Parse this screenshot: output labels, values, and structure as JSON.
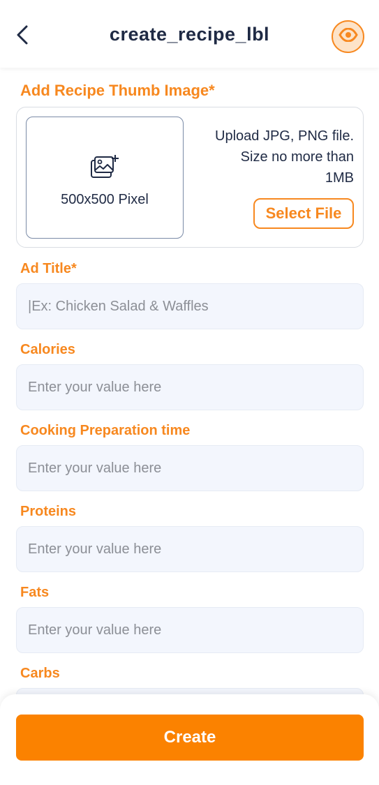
{
  "header": {
    "title": "create_recipe_lbl",
    "back_icon": "chevron-left-icon",
    "preview_icon": "eye-icon"
  },
  "thumb": {
    "label": "Add Recipe Thumb Image*",
    "size_text": "500x500 Pixel",
    "icon": "image-add-icon",
    "info_line1": "Upload JPG, PNG file.",
    "info_line2": "Size no more than",
    "info_line3": "1MB",
    "select_label": "Select File"
  },
  "fields": {
    "ad_title": {
      "label": "Ad Title*",
      "placeholder": "|Ex: Chicken Salad & Waffles"
    },
    "calories": {
      "label": "Calories",
      "placeholder": "Enter your value here"
    },
    "cooking_time": {
      "label": "Cooking Preparation time",
      "placeholder": "Enter your value here"
    },
    "proteins": {
      "label": "Proteins",
      "placeholder": "Enter your value here"
    },
    "fats": {
      "label": "Fats",
      "placeholder": "Enter your value here"
    },
    "carbs": {
      "label": "Carbs",
      "placeholder": ""
    }
  },
  "footer": {
    "create_label": "Create"
  },
  "colors": {
    "accent": "#f7881f",
    "primary_button": "#fb8200",
    "text_dark": "#1f2a44",
    "field_bg": "#f3f6fd"
  }
}
